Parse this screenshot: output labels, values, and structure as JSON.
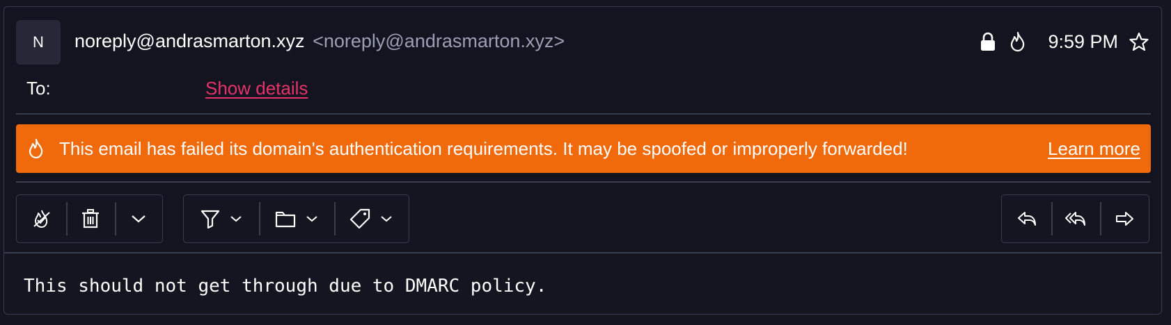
{
  "header": {
    "avatar_initial": "N",
    "sender_name": "noreply@andrasmarton.xyz",
    "sender_address": "<noreply@andrasmarton.xyz>",
    "time": "9:59 PM",
    "to_label": "To:",
    "show_details": "Show details"
  },
  "banner": {
    "icon": "flame-icon",
    "message": "This email has failed its domain's authentication requirements. It may be spoofed or improperly forwarded!",
    "learn_more": "Learn more",
    "color": "#f06a0c"
  },
  "toolbar": {
    "left_group": [
      "not-spam-icon",
      "trash-icon",
      "chevron-down-icon"
    ],
    "middle_group": [
      "filter-icon",
      "folder-icon",
      "tag-icon"
    ],
    "right_group": [
      "reply-icon",
      "reply-all-icon",
      "forward-icon"
    ]
  },
  "body": {
    "text": "This should not get through due to DMARC policy."
  },
  "colors": {
    "background": "#141520",
    "accent_link": "#e8336a",
    "border": "#3a3d50",
    "muted_text": "#9c9fb5"
  }
}
